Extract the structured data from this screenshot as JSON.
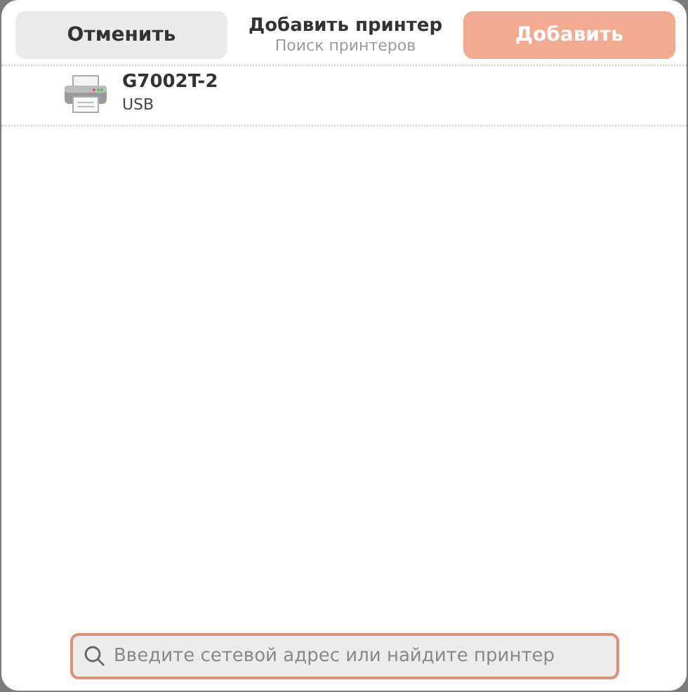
{
  "header": {
    "title": "Добавить принтер",
    "subtitle": "Поиск принтеров",
    "cancel_button": {
      "label": "Отменить"
    },
    "add_button": {
      "label": "Добавить",
      "disabled": true
    }
  },
  "printers": [
    {
      "name": "G7002T-2",
      "connection": "USB",
      "selected": false
    }
  ],
  "search": {
    "placeholder": "Введите сетевой адрес или найдите принтер",
    "focused": true
  }
}
